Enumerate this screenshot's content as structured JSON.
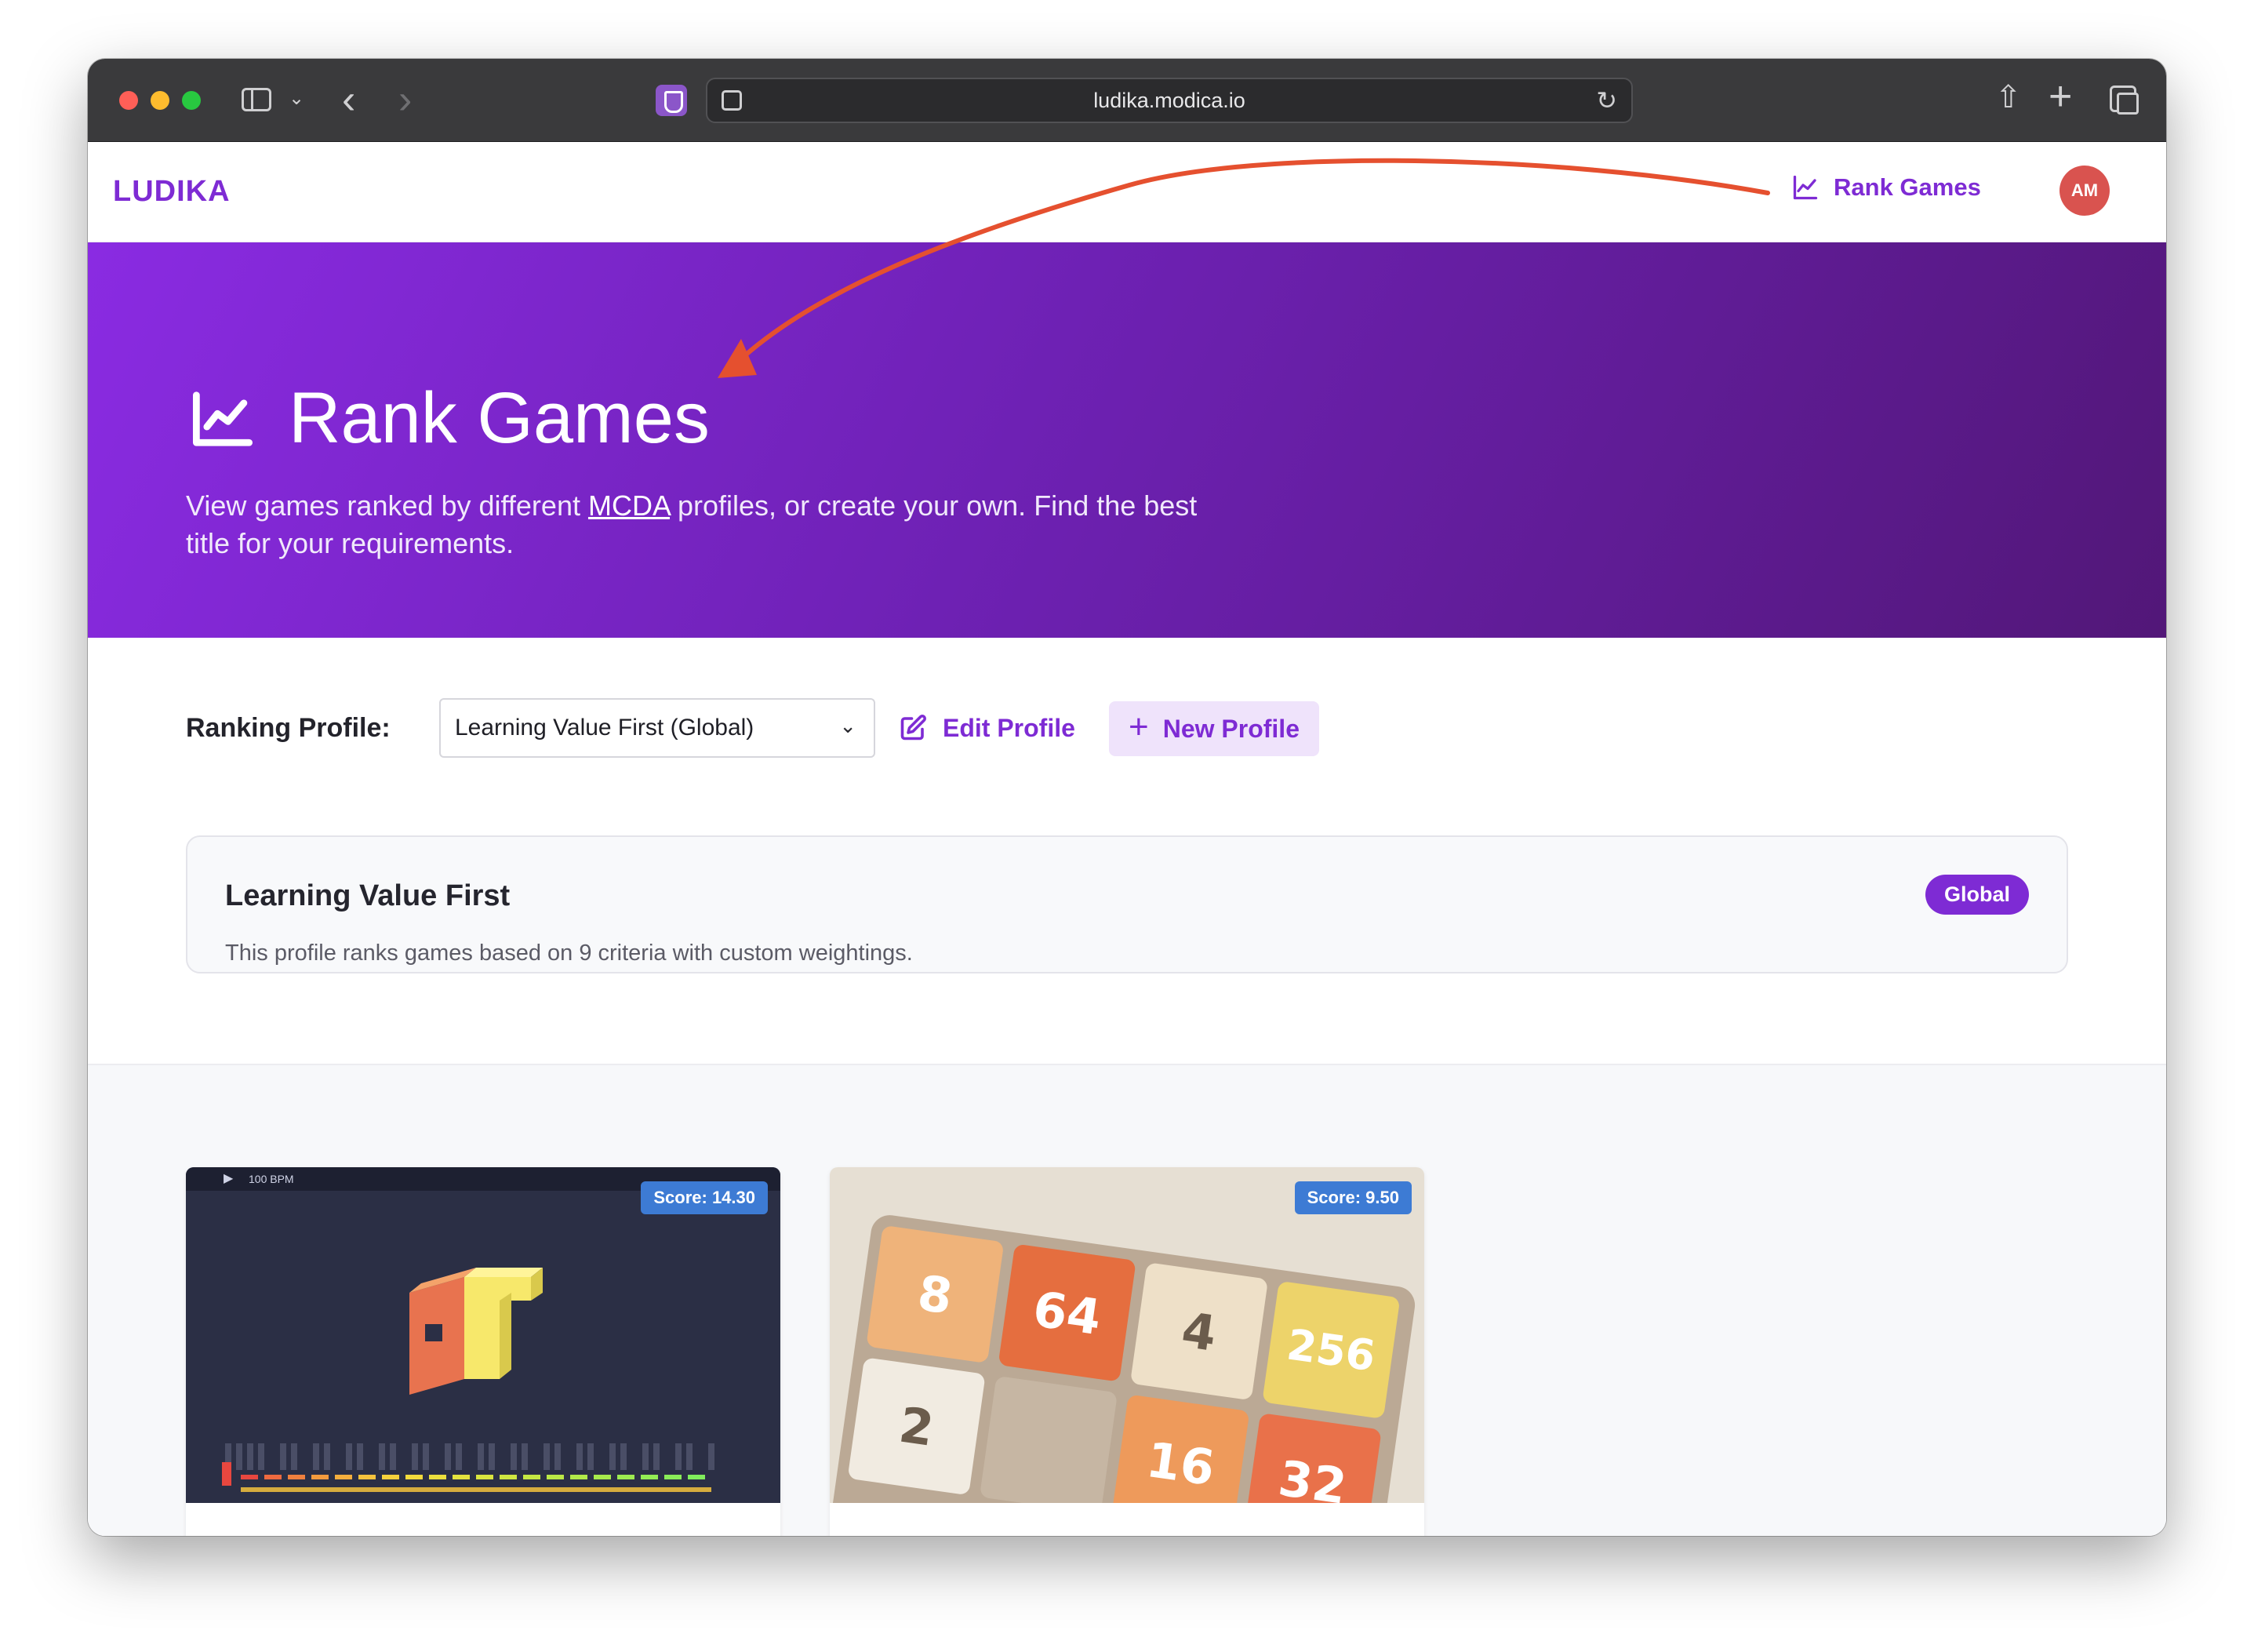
{
  "browser": {
    "url": "ludika.modica.io"
  },
  "nav": {
    "logo": "LUDIKA",
    "link_label": "Rank Games",
    "avatar_initials": "AM"
  },
  "hero": {
    "title": "Rank Games",
    "desc_before": "View games ranked by different ",
    "desc_link": "MCDA",
    "desc_after": " profiles, or create your own. Find the best title for your requirements."
  },
  "controls": {
    "profile_label": "Ranking Profile:",
    "selected_profile": "Learning Value First (Global)",
    "edit_label": "Edit Profile",
    "new_label": "New Profile"
  },
  "profile_card": {
    "title": "Learning Value First",
    "description": "This profile ranks games based on 9 criteria with custom weightings.",
    "badge": "Global"
  },
  "games": [
    {
      "score_label": "Score: 14.30",
      "toolbar_text": "100 BPM"
    },
    {
      "score_label": "Score: 9.50",
      "tiles": [
        "8",
        "64",
        "4",
        "256",
        "2",
        "",
        "16",
        "32"
      ]
    }
  ],
  "colors": {
    "accent": "#7e2bd4",
    "annotation": "#e5502f",
    "score_badge": "#3d7bd4"
  }
}
